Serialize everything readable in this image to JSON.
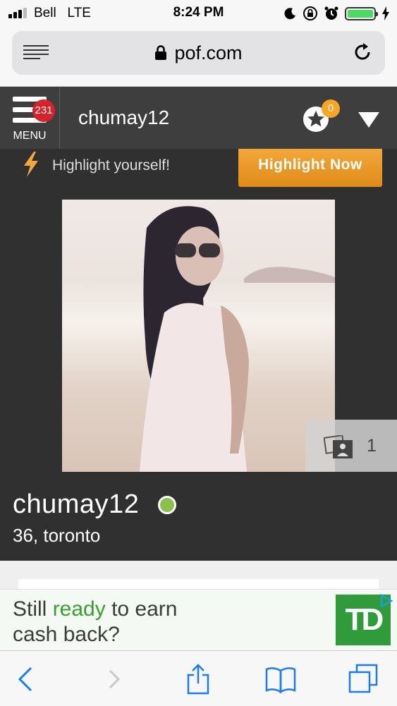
{
  "status_bar": {
    "carrier": "Bell",
    "network": "LTE",
    "time": "8:24 PM",
    "battery_level": 1.0,
    "icons": [
      "signal-icon",
      "moon-icon",
      "orientation-lock-icon",
      "alarm-icon",
      "battery-icon",
      "charging-icon"
    ]
  },
  "browser": {
    "domain": "pof.com",
    "icons": [
      "reader-icon",
      "lock-icon",
      "reload-icon"
    ]
  },
  "app_header": {
    "menu_label": "MENU",
    "menu_badge": "231",
    "username": "chumay12",
    "notification_badge": "0",
    "icons": [
      "globe-star-icon",
      "dropdown-arrow-icon"
    ]
  },
  "highlight": {
    "text": "Highlight yourself!",
    "button_label": "Highlight Now"
  },
  "profile": {
    "name": "chumay12",
    "details": "36, toronto",
    "photo_count": "1",
    "online": true
  },
  "ad": {
    "line1_prefix": "Still ",
    "line1_highlight": "ready",
    "line1_suffix": " to earn",
    "line2": "cash back?",
    "logo_text": "TD"
  },
  "colors": {
    "header_bg": "#3e3e3e",
    "profile_bg": "#303030",
    "badge_red": "#d6232a",
    "badge_orange": "#f6a623",
    "highlight_button": "#e8951e",
    "online_green": "#8cc04b",
    "td_green": "#2f9b3b",
    "ios_blue": "#1a7cf5"
  },
  "toolbar": {
    "icons": [
      "back-icon",
      "forward-icon",
      "share-icon",
      "bookmarks-icon",
      "tabs-icon"
    ]
  }
}
